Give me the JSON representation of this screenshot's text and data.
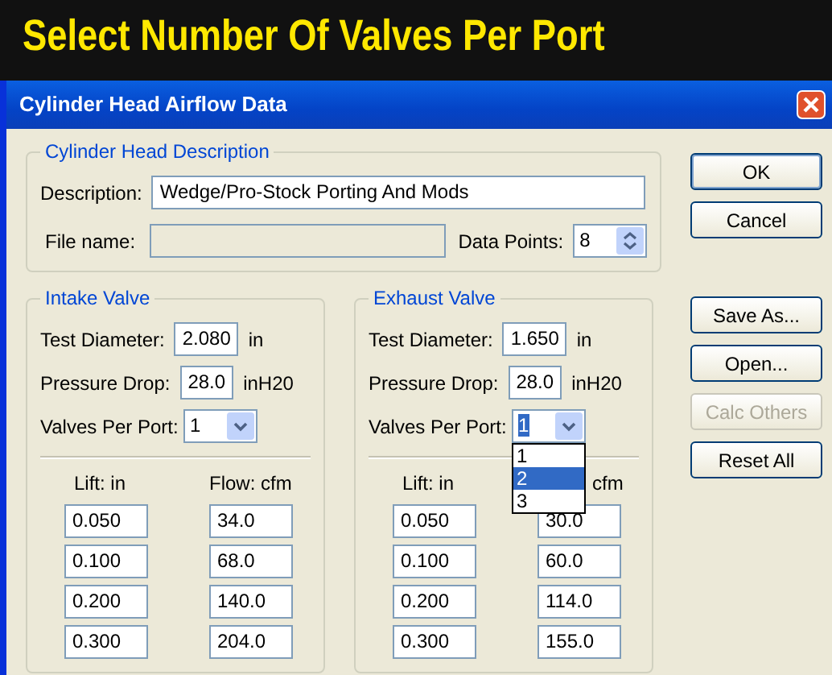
{
  "banner": {
    "title": "Select Number Of Valves Per Port"
  },
  "window": {
    "title": "Cylinder Head Airflow Data"
  },
  "description_group": {
    "title": "Cylinder Head Description",
    "description_label": "Description:",
    "description_value": "Wedge/Pro-Stock Porting And Mods",
    "file_name_label": "File name:",
    "data_points_label": "Data Points:",
    "data_points_value": "8"
  },
  "valves": [
    {
      "title": "Intake Valve",
      "test_diameter_label": "Test Diameter:",
      "test_diameter": "2.080",
      "test_diameter_unit": "in",
      "pressure_drop_label": "Pressure Drop:",
      "pressure_drop": "28.0",
      "pressure_drop_unit": "inH20",
      "valves_per_port_label": "Valves Per Port:",
      "valves_per_port": "1",
      "focused": false,
      "lift_header": "Lift: in",
      "flow_header": "Flow: cfm",
      "rows": [
        {
          "lift": "0.050",
          "flow": "34.0"
        },
        {
          "lift": "0.100",
          "flow": "68.0"
        },
        {
          "lift": "0.200",
          "flow": "140.0"
        },
        {
          "lift": "0.300",
          "flow": "204.0"
        }
      ]
    },
    {
      "title": "Exhaust Valve",
      "test_diameter_label": "Test Diameter:",
      "test_diameter": "1.650",
      "test_diameter_unit": "in",
      "pressure_drop_label": "Pressure Drop:",
      "pressure_drop": "28.0",
      "pressure_drop_unit": "inH20",
      "valves_per_port_label": "Valves Per Port:",
      "valves_per_port": "1",
      "focused": true,
      "lift_header": "Lift: in",
      "flow_header": "cfm",
      "rows": [
        {
          "lift": "0.050",
          "flow": "30.0"
        },
        {
          "lift": "0.100",
          "flow": "60.0"
        },
        {
          "lift": "0.200",
          "flow": "114.0"
        },
        {
          "lift": "0.300",
          "flow": "155.0"
        }
      ],
      "dropdown": [
        {
          "label": "1",
          "selected": false
        },
        {
          "label": "2",
          "selected": true
        },
        {
          "label": "3",
          "selected": false
        }
      ]
    }
  ],
  "buttons_top": [
    {
      "label": "OK",
      "disabled": false,
      "default": true
    },
    {
      "label": "Cancel",
      "disabled": false,
      "default": false
    }
  ],
  "buttons_bottom": [
    {
      "label": "Save As...",
      "disabled": false,
      "default": false
    },
    {
      "label": "Open...",
      "disabled": false,
      "default": false
    },
    {
      "label": "Calc Others",
      "disabled": true,
      "default": false
    },
    {
      "label": "Reset All",
      "disabled": false,
      "default": false
    }
  ]
}
